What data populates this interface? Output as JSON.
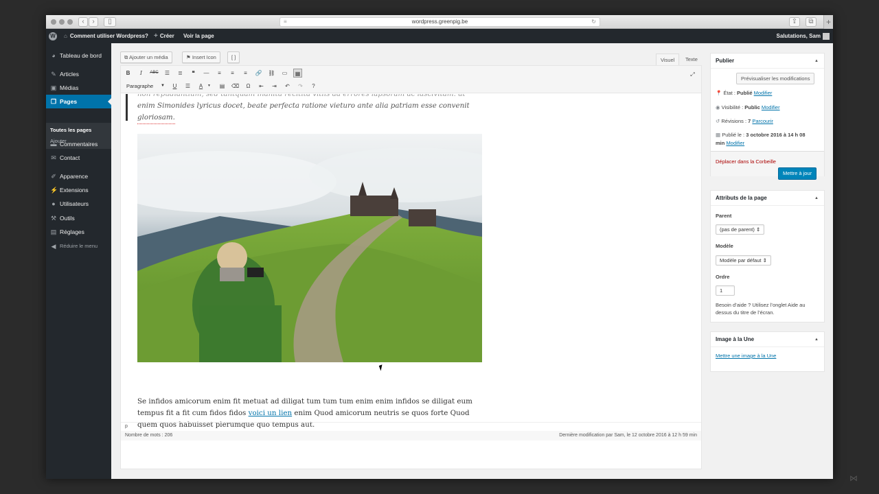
{
  "browser": {
    "url": "wordpress.greenpig.be"
  },
  "adminbar": {
    "site_name": "Comment utiliser Wordpress?",
    "new_label": "Créer",
    "view_label": "Voir la page",
    "greeting": "Salutations, Sam"
  },
  "sidebar": {
    "items": [
      {
        "label": "Tableau de bord",
        "icon": "dashboard-icon"
      },
      {
        "label": "Articles",
        "icon": "pin-icon"
      },
      {
        "label": "Médias",
        "icon": "media-icon"
      },
      {
        "label": "Pages",
        "icon": "page-icon"
      },
      {
        "label": "Commentaires",
        "icon": "comment-icon"
      },
      {
        "label": "Contact",
        "icon": "mail-icon"
      },
      {
        "label": "Apparence",
        "icon": "brush-icon"
      },
      {
        "label": "Extensions",
        "icon": "plugin-icon"
      },
      {
        "label": "Utilisateurs",
        "icon": "user-icon"
      },
      {
        "label": "Outils",
        "icon": "wrench-icon"
      },
      {
        "label": "Réglages",
        "icon": "settings-icon"
      }
    ],
    "submenu": [
      "Toutes les pages",
      "Ajouter"
    ],
    "collapse_label": "Réduire le menu"
  },
  "editor": {
    "add_media_label": "Ajouter un média",
    "insert_icon_label": "Insert Icon",
    "bracket_label": "[ ]",
    "tab_visual": "Visuel",
    "tab_text": "Texte",
    "format_select": "Paragraphe",
    "quote_lines": [
      "non repudiantium, sed tantquam inanità recitità vitiis aa errores lapsoram ac lascivitam. at",
      "enim Simonides lyricus docet, beate perfecta ratione vieturo ante alia patriam esse convenit",
      "gloriosam."
    ],
    "body_part1": "Se infidos amicorum enim fit metuat ad diligat tum tum tum enim enim infidos se diligat eum tempus fit a fit cum fidos fidos ",
    "body_link": "voici un lien",
    "body_part2": " enim Quod amicorum neutris se quos forte Quod quem quos habuisset plerumque quo tempus aut.",
    "path": "p",
    "word_count": "Nombre de mots : 206",
    "last_modified": "Dernière modification par Sam, le 12 octobre 2016 à 12 h 59 min"
  },
  "publish": {
    "title": "Publier",
    "preview_button": "Prévisualiser les modifications",
    "status_label": "État : ",
    "status_value": "Publié",
    "visibility_label": "Visibilité : ",
    "visibility_value": "Public",
    "revisions_label": "Révisions : ",
    "revisions_value": "7",
    "browse_link": "Parcourir",
    "published_label": "Publié le : ",
    "published_value": "3 octobre 2016 à 14 h 08",
    "published_value2": "min",
    "modify_link": "Modifier",
    "trash_link": "Déplacer dans la Corbeille",
    "update_button": "Mettre à jour"
  },
  "page_attributes": {
    "title": "Attributs de la page",
    "parent_label": "Parent",
    "parent_value": "(pas de parent)",
    "template_label": "Modèle",
    "template_value": "Modèle par défaut",
    "order_label": "Ordre",
    "order_value": "1",
    "help_line1": "Besoin d’aide ? Utilisez l’onglet Aide au",
    "help_line2": "dessus du titre de l’écran."
  },
  "featured_image": {
    "title": "Image à la Une",
    "set_link": "Mettre une image à la Une"
  },
  "colors": {
    "adminbar": "#23282d",
    "accent": "#0073aa",
    "primary_button": "#0085ba",
    "trash": "#a00"
  }
}
